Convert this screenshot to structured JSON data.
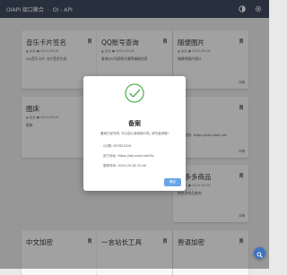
{
  "header": {
    "brand": "OIAPI 接口聚合",
    "sub": "OI - API"
  },
  "cards": [
    {
      "title": "音乐卡片签名",
      "meta": "▲ 后台 ● 2024-06-26",
      "desc": "QQ音乐卡片 卡片签名生成",
      "more": "详情"
    },
    {
      "title": "QQ账号查询",
      "meta": "▲ 后台 ● 2024-06-26",
      "desc": "查询QQ号昵称头像等基础信息",
      "more": "详情"
    },
    {
      "title": "随便图片",
      "meta": "▲ 后台 ● 2024-06-26",
      "desc": "随便的图片接口",
      "more": "详情"
    },
    {
      "title": "图床",
      "meta": "▲ 后台 ● 2024-06-26",
      "desc": "图床",
      "more": "详情"
    },
    {
      "title": "",
      "meta": "",
      "desc": "接口地址: https://api.oiapi.net",
      "more": "详情"
    },
    {
      "title": "拼多多商品",
      "meta": "▲ 后台 ● 2024-06-26",
      "desc": "拼多多商品查询",
      "more": "详情"
    },
    {
      "title": "中文加密",
      "meta": "",
      "desc": "",
      "more": ""
    },
    {
      "title": "一言站长工具",
      "meta": "",
      "desc": "",
      "more": ""
    },
    {
      "title": "兽语加密",
      "meta": "",
      "desc": "",
      "more": ""
    }
  ],
  "modal": {
    "title": "备案",
    "desc": "备案已经完成, 可以放心使用接口啦, 请勿滥用哦!",
    "qq_label": "QQ群:",
    "qq_value": "637823219",
    "url_label": "官方地址:",
    "url_value": "https://api.oiapi.net/Go",
    "time_label": "更新时间:",
    "time_value": "2024-05-28 22:46",
    "ok_label": "确定"
  },
  "colors": {
    "header": "#3f4a5e",
    "accent": "#3e73bd",
    "check": "#4caf50",
    "button": "#69a6e8"
  },
  "icons": [
    "theme-icon",
    "settings-icon",
    "search-icon",
    "check-icon",
    "bookmark-icon"
  ]
}
